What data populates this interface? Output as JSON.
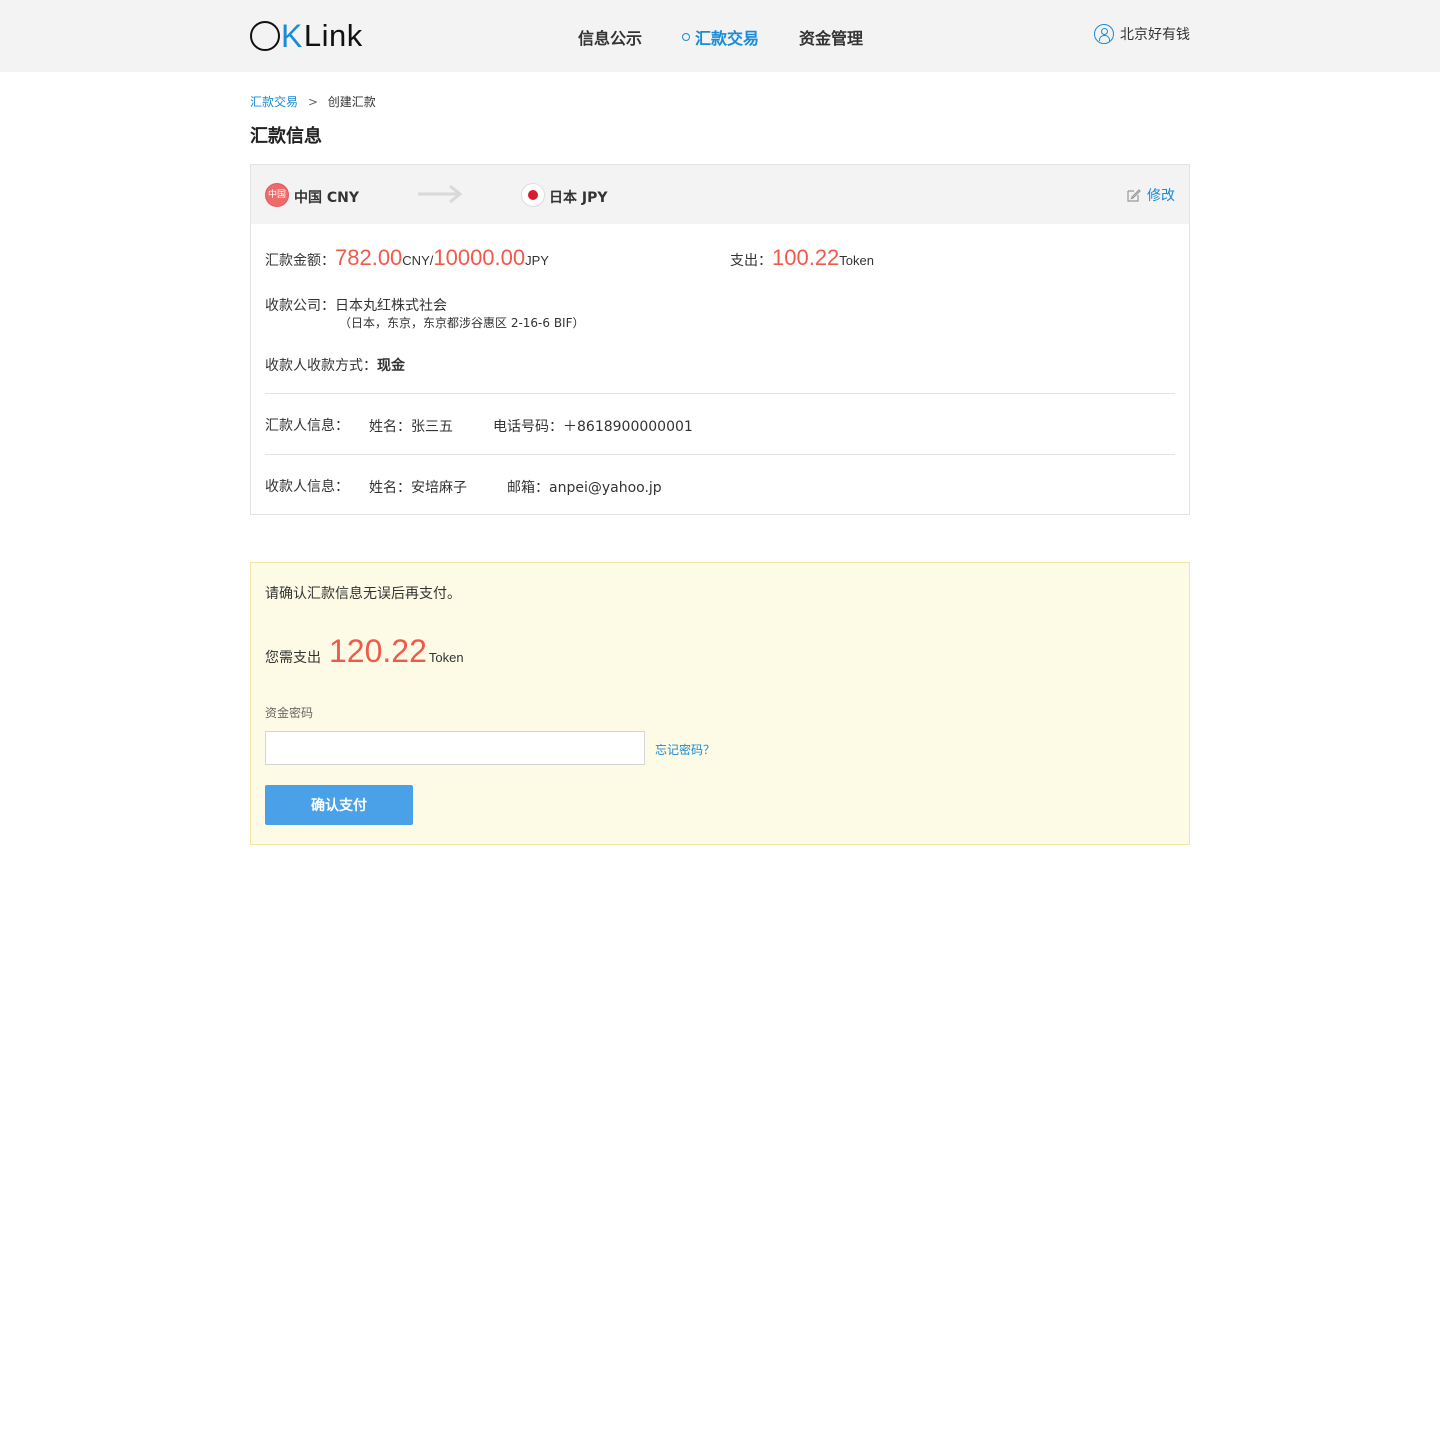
{
  "header": {
    "logo": {
      "o": "O",
      "k": "K",
      "rest": "Link"
    },
    "nav": [
      {
        "label": "信息公示"
      },
      {
        "label": "汇款交易"
      },
      {
        "label": "资金管理"
      }
    ],
    "user_name": "北京好有钱"
  },
  "breadcrumb": {
    "parent": "汇款交易",
    "separator": ">",
    "current": "创建汇款"
  },
  "page_title": "汇款信息",
  "card": {
    "from_flag_text": "中国",
    "from_currency": "中国 CNY",
    "to_currency": "日本 JPY",
    "edit_label": "修改",
    "amount_label": "汇款金额：",
    "amount_cny": "782.00",
    "amount_cny_unit": "CNY/",
    "amount_jpy": "10000.00",
    "amount_jpy_unit": "JPY",
    "expense_label": "支出：",
    "expense_value": "100.22",
    "expense_unit": "Token",
    "company_label": "收款公司：",
    "company_name": "日本丸红株式社会",
    "company_address": "（日本，东京，东京都涉谷惠区 2-16-6 BIF）",
    "method_label": "收款人收款方式：",
    "method_value": "现金",
    "sender_label": "汇款人信息：",
    "sender_name": "姓名：张三五",
    "sender_phone": "电话号码：＋8618900000001",
    "receiver_label": "收款人信息：",
    "receiver_name": "姓名：安培麻子",
    "receiver_email": "邮箱：anpei@yahoo.jp"
  },
  "confirm": {
    "tip": "请确认汇款信息无误后再支付。",
    "pay_label": "您需支出",
    "pay_amount": "120.22",
    "pay_unit": "Token",
    "password_label": "资金密码",
    "password_value": "",
    "forgot_label": "忘记密码？",
    "submit_label": "确认支付"
  },
  "colors": {
    "accent": "#1a8bd6",
    "amount_red": "#f15a4a",
    "button_blue": "#4aa1e8",
    "notice_bg": "#fdfbe6"
  }
}
